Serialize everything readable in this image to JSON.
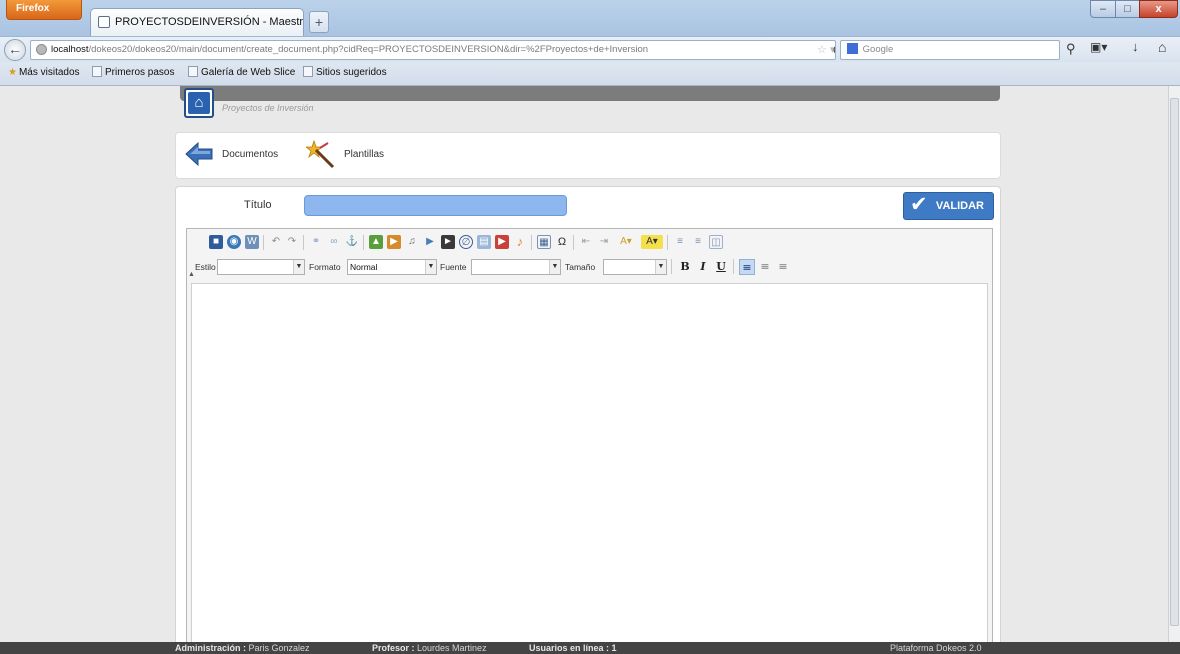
{
  "browser": {
    "menu_label": "Firefox",
    "tab_title": "PROYECTOSDEINVERSIÓN - Maestría en ...",
    "newtab_label": "+",
    "url_host": "localhost",
    "url_path": "/dokeos20/dokeos20/main/document/create_document.php?cidReq=PROYECTOSDEINVERSION&dir=%2FProyectos+de+Inversion",
    "search_placeholder": "Google",
    "bookmarks": [
      "Más visitados",
      "Primeros pasos",
      "Galería de Web Slice",
      "Sitios sugeridos"
    ]
  },
  "page": {
    "course_name": "Proyectos de Inversión",
    "actions": {
      "documents_label": "Documentos",
      "templates_label": "Plantillas"
    },
    "form": {
      "title_label": "Título",
      "title_value": "",
      "validate_label": "VALIDAR"
    },
    "editor": {
      "style_label": "Estilo",
      "style_value": "",
      "format_label": "Formato",
      "format_value": "Normal",
      "font_label": "Fuente",
      "font_value": "",
      "size_label": "Tamaño",
      "size_value": "",
      "bold_label": "B",
      "italic_label": "I",
      "underline_label": "U"
    },
    "colors": {
      "accent": "#3f7bc4",
      "title_input": "#8db7ee",
      "footer": "#444444"
    }
  },
  "footer": {
    "admin_label": "Administración :",
    "admin_name": "Paris Gonzalez",
    "teacher_label": "Profesor :",
    "teacher_name": "Lourdes Martinez",
    "online_label": "Usuarios en línea : 1",
    "platform": "Plataforma Dokeos 2.0"
  }
}
